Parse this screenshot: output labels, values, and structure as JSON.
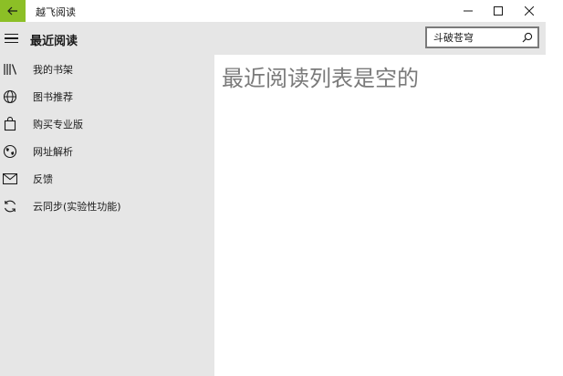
{
  "window": {
    "app_title": "越飞阅读",
    "back_icon": "back-arrow-icon",
    "accent_color": "#8cbf26"
  },
  "header": {
    "title": "最近阅读",
    "menu_icon": "hamburger-icon"
  },
  "search": {
    "value": "斗破苍穹",
    "icon": "search-icon"
  },
  "sidebar": {
    "items": [
      {
        "label": "我的书架",
        "icon": "bookshelf-icon"
      },
      {
        "label": "图书推荐",
        "icon": "globe-icon"
      },
      {
        "label": "购买专业版",
        "icon": "shopping-bag-icon"
      },
      {
        "label": "网址解析",
        "icon": "world-icon"
      },
      {
        "label": "反馈",
        "icon": "mail-icon"
      },
      {
        "label": "云同步(实验性功能)",
        "icon": "sync-icon"
      }
    ]
  },
  "main": {
    "empty_message": "最近阅读列表是空的"
  }
}
